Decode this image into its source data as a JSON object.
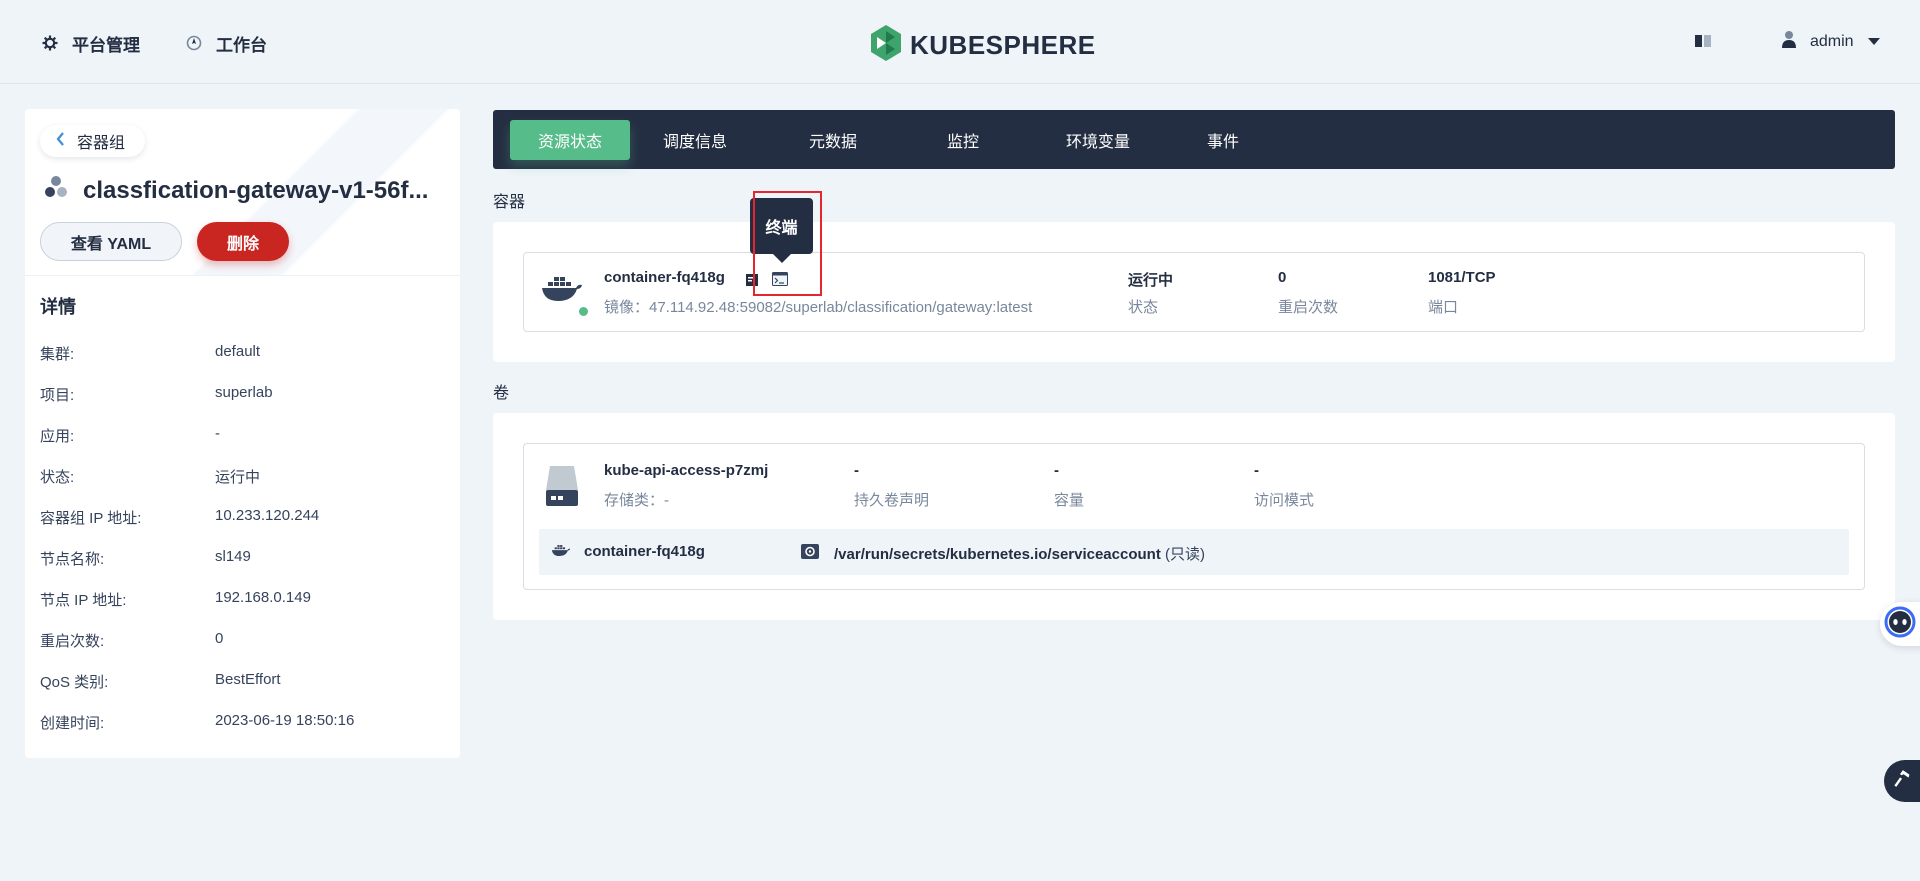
{
  "topbar": {
    "platform_label": "平台管理",
    "workbench_label": "工作台",
    "logo_text": "KUBESPHERE",
    "user_name": "admin"
  },
  "left": {
    "back_label": "容器组",
    "pod_name": "classfication-gateway-v1-56f...",
    "yaml_button": "查看 YAML",
    "delete_button": "删除",
    "detail_heading": "详情",
    "details": [
      {
        "key": "集群:",
        "value": "default"
      },
      {
        "key": "项目:",
        "value": "superlab"
      },
      {
        "key": "应用:",
        "value": "-"
      },
      {
        "key": "状态:",
        "value": "运行中"
      },
      {
        "key": "容器组 IP 地址:",
        "value": "10.233.120.244"
      },
      {
        "key": "节点名称:",
        "value": "sl149"
      },
      {
        "key": "节点 IP 地址:",
        "value": "192.168.0.149"
      },
      {
        "key": "重启次数:",
        "value": "0"
      },
      {
        "key": "QoS 类别:",
        "value": "BestEffort"
      },
      {
        "key": "创建时间:",
        "value": "2023-06-19 18:50:16"
      }
    ]
  },
  "tabs": [
    "资源状态",
    "调度信息",
    "元数据",
    "监控",
    "环境变量",
    "事件"
  ],
  "containers_section": {
    "title": "容器",
    "container": {
      "name": "container-fq418g",
      "image": "镜像：47.114.92.48:59082/superlab/classification/gateway:latest",
      "status_value": "运行中",
      "status_label": "状态",
      "restarts_value": "0",
      "restarts_label": "重启次数",
      "port_value": "1081/TCP",
      "port_label": "端口"
    },
    "tooltip": "终端"
  },
  "volumes_section": {
    "title": "卷",
    "volume": {
      "name": "kube-api-access-p7zmj",
      "storage_class": "存储类：-",
      "pvc_value": "-",
      "pvc_label": "持久卷声明",
      "capacity_value": "-",
      "capacity_label": "容量",
      "access_value": "-",
      "access_label": "访问模式"
    },
    "mount": {
      "container": "container-fq418g",
      "path": "/var/run/secrets/kubernetes.io/serviceaccount",
      "mode": "(只读)"
    }
  },
  "colors": {
    "accent_green": "#55bc8a",
    "dark_nav": "#242e42",
    "danger_red": "#ca2621",
    "highlight_red": "#e5272d"
  }
}
